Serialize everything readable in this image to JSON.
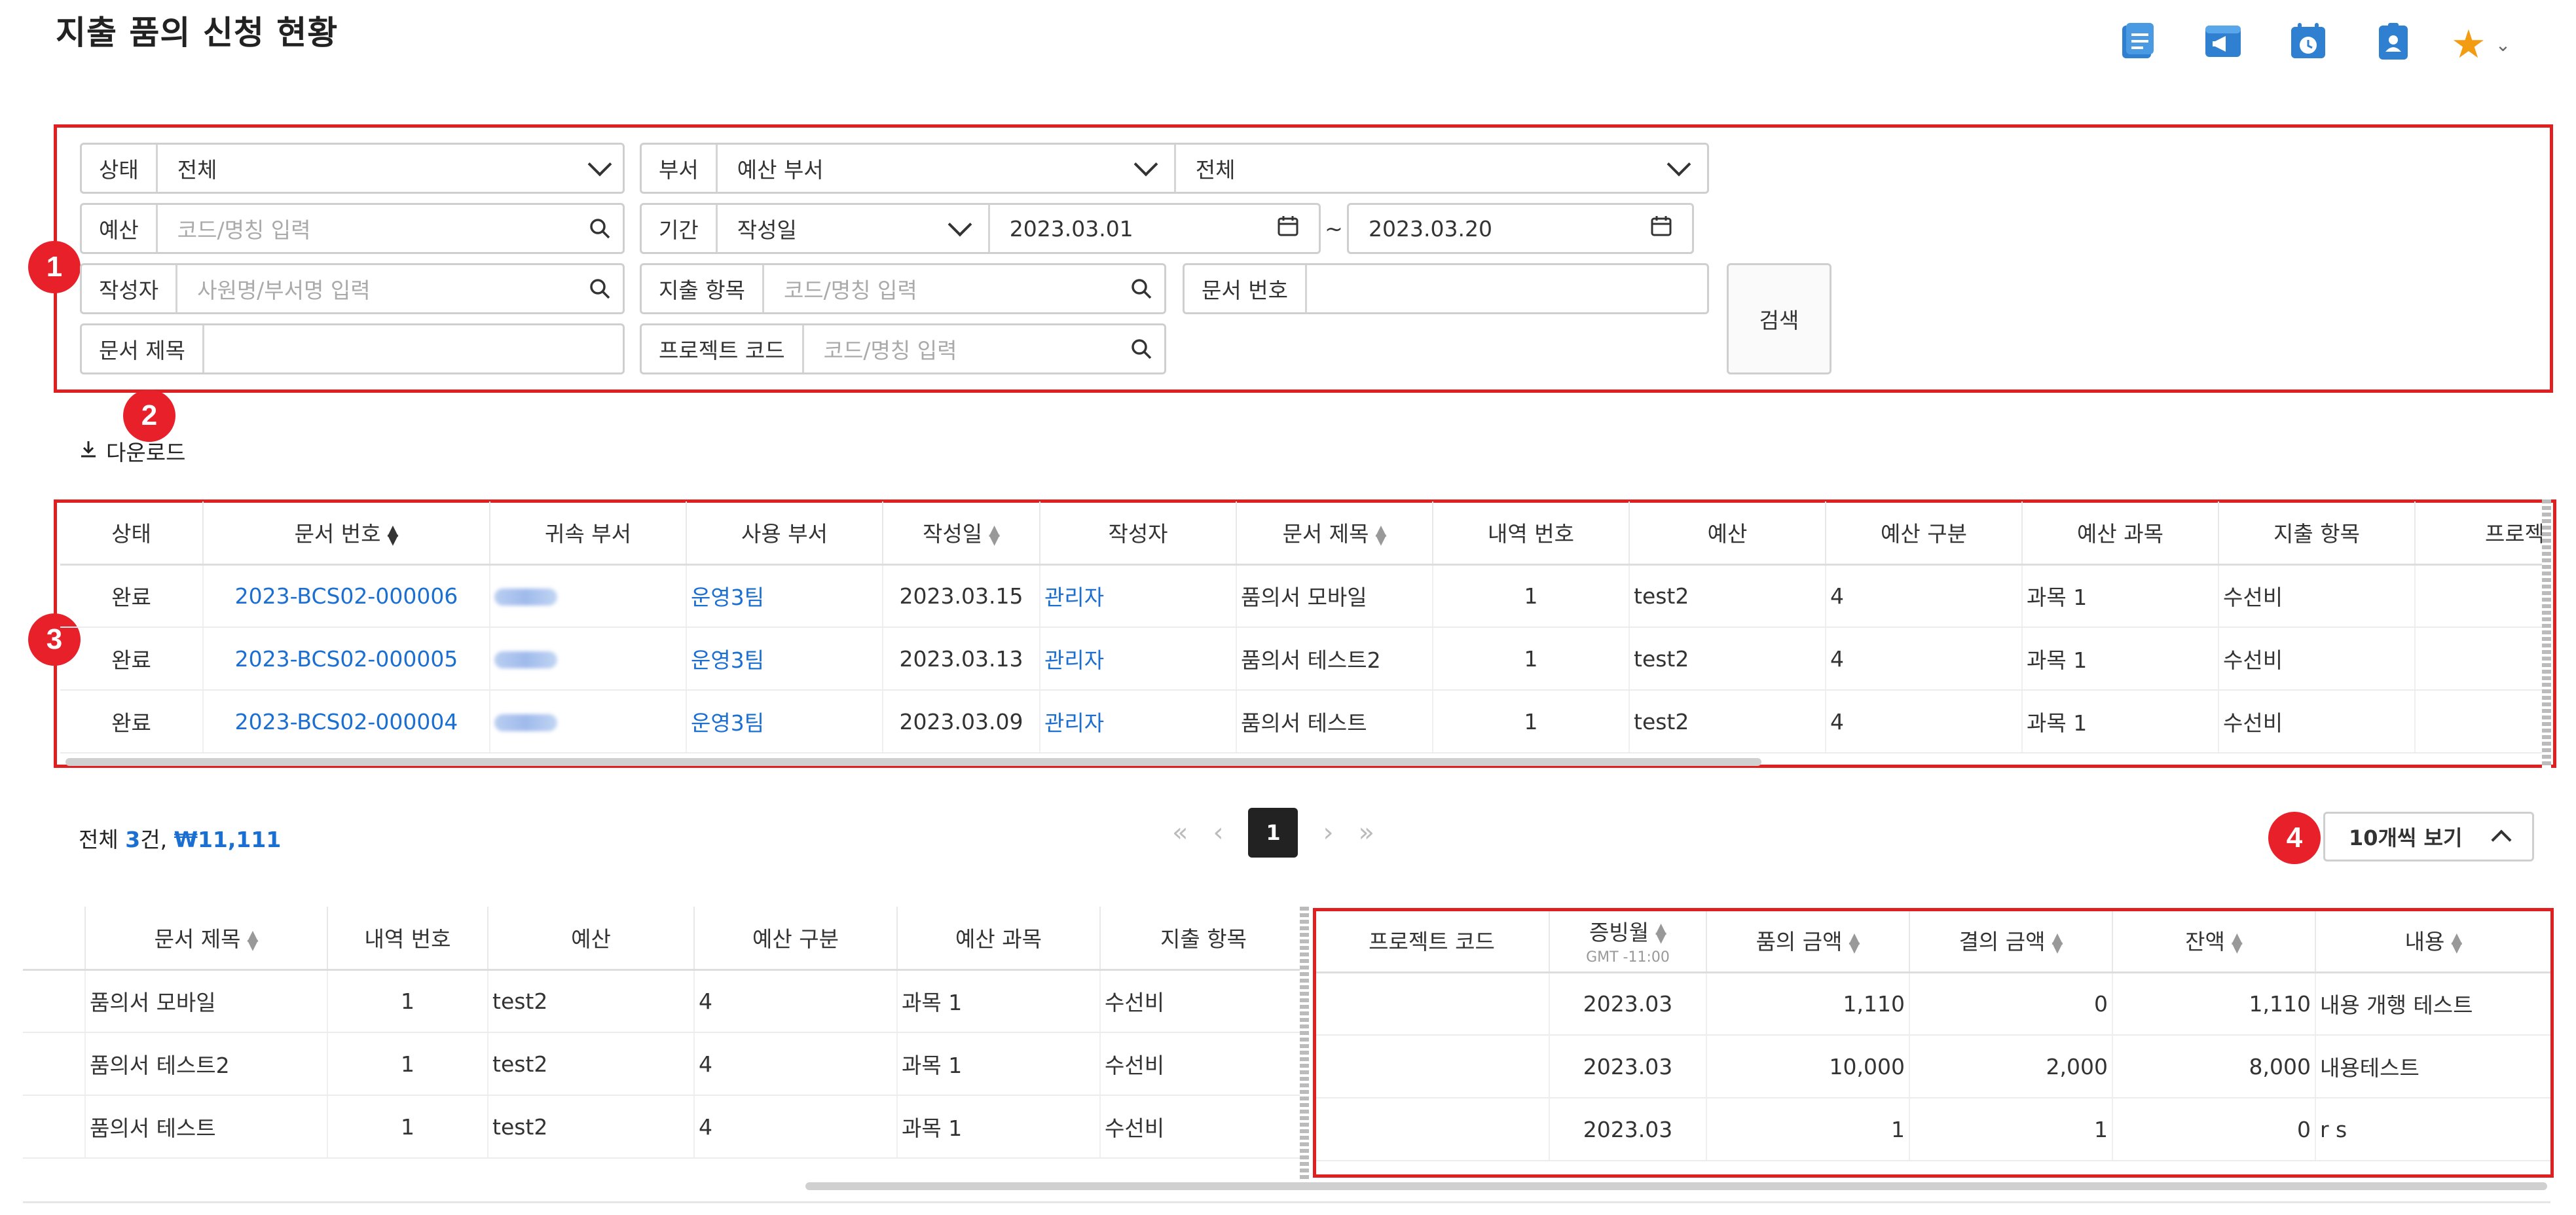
{
  "page": {
    "title": "지출 품의 신청 현황"
  },
  "header_icons": [
    "document-list-icon",
    "megaphone-icon",
    "calendar-clock-icon",
    "contact-card-icon",
    "star-icon"
  ],
  "markers": [
    "1",
    "2",
    "3",
    "4"
  ],
  "filters": {
    "status": {
      "label": "상태",
      "value": "전체"
    },
    "department": {
      "label": "부서",
      "value": "예산 부서",
      "value2": "전체"
    },
    "budget": {
      "label": "예산",
      "placeholder": "코드/명칭 입력"
    },
    "period": {
      "label": "기간",
      "type": "작성일",
      "start": "2023.03.01",
      "sep": "~",
      "end": "2023.03.20"
    },
    "writer": {
      "label": "작성자",
      "placeholder": "사원명/부서명 입력"
    },
    "expense_item": {
      "label": "지출 항목",
      "placeholder": "코드/명칭 입력"
    },
    "doc_no": {
      "label": "문서 번호",
      "value": ""
    },
    "doc_title": {
      "label": "문서 제목",
      "value": ""
    },
    "project_code": {
      "label": "프로젝트 코드",
      "placeholder": "코드/명칭 입력"
    },
    "search_button": "검색"
  },
  "download_label": "다운로드",
  "table1": {
    "columns": [
      "상태",
      "문서 번호",
      "귀속 부서",
      "사용 부서",
      "작성일",
      "작성자",
      "문서 제목",
      "내역 번호",
      "예산",
      "예산 구분",
      "예산 과목",
      "지출 항목",
      "프로젝"
    ],
    "rows": [
      {
        "status": "완료",
        "doc_no": "2023-BCS02-000006",
        "use_dept": "운영3팀",
        "date": "2023.03.15",
        "writer": "관리자",
        "title": "품의서 모바일",
        "item_no": "1",
        "budget": "test2",
        "budget_type": "4",
        "budget_subject": "과목 1",
        "expense_item": "수선비"
      },
      {
        "status": "완료",
        "doc_no": "2023-BCS02-000005",
        "use_dept": "운영3팀",
        "date": "2023.03.13",
        "writer": "관리자",
        "title": "품의서 테스트2",
        "item_no": "1",
        "budget": "test2",
        "budget_type": "4",
        "budget_subject": "과목 1",
        "expense_item": "수선비"
      },
      {
        "status": "완료",
        "doc_no": "2023-BCS02-000004",
        "use_dept": "운영3팀",
        "date": "2023.03.09",
        "writer": "관리자",
        "title": "품의서 테스트",
        "item_no": "1",
        "budget": "test2",
        "budget_type": "4",
        "budget_subject": "과목 1",
        "expense_item": "수선비"
      }
    ]
  },
  "summary": {
    "prefix": "전체",
    "count": "3",
    "unit": "건,",
    "amount": "₩11,111"
  },
  "pagination": {
    "first": "«",
    "prev": "‹",
    "current": "1",
    "next": "›",
    "last": "»"
  },
  "per_page": "10개씩 보기",
  "table2": {
    "columns": [
      "문서 제목",
      "내역 번호",
      "예산",
      "예산 구분",
      "예산 과목",
      "지출 항목"
    ],
    "right_columns": [
      "프로젝트 코드",
      "증빙월",
      "품의 금액",
      "결의 금액",
      "잔액",
      "내용"
    ],
    "timezone_note": "GMT -11:00",
    "rows": [
      {
        "title": "품의서 모바일",
        "item_no": "1",
        "budget": "test2",
        "budget_type": "4",
        "budget_subject": "과목 1",
        "expense_item": "수선비",
        "project_code": "",
        "month": "2023.03",
        "request_amount": "1,110",
        "resolved_amount": "0",
        "balance": "1,110",
        "content": "내용 개행 테스트"
      },
      {
        "title": "품의서 테스트2",
        "item_no": "1",
        "budget": "test2",
        "budget_type": "4",
        "budget_subject": "과목 1",
        "expense_item": "수선비",
        "project_code": "",
        "month": "2023.03",
        "request_amount": "10,000",
        "resolved_amount": "2,000",
        "balance": "8,000",
        "content": "내용테스트"
      },
      {
        "title": "품의서 테스트",
        "item_no": "1",
        "budget": "test2",
        "budget_type": "4",
        "budget_subject": "과목 1",
        "expense_item": "수선비",
        "project_code": "",
        "month": "2023.03",
        "request_amount": "1",
        "resolved_amount": "1",
        "balance": "0",
        "content": "r s"
      }
    ]
  },
  "colors": {
    "accent": "#1a6fd1",
    "annotation": "#e02020",
    "icon_blue": "#2f80d1",
    "star": "#f39c12"
  }
}
